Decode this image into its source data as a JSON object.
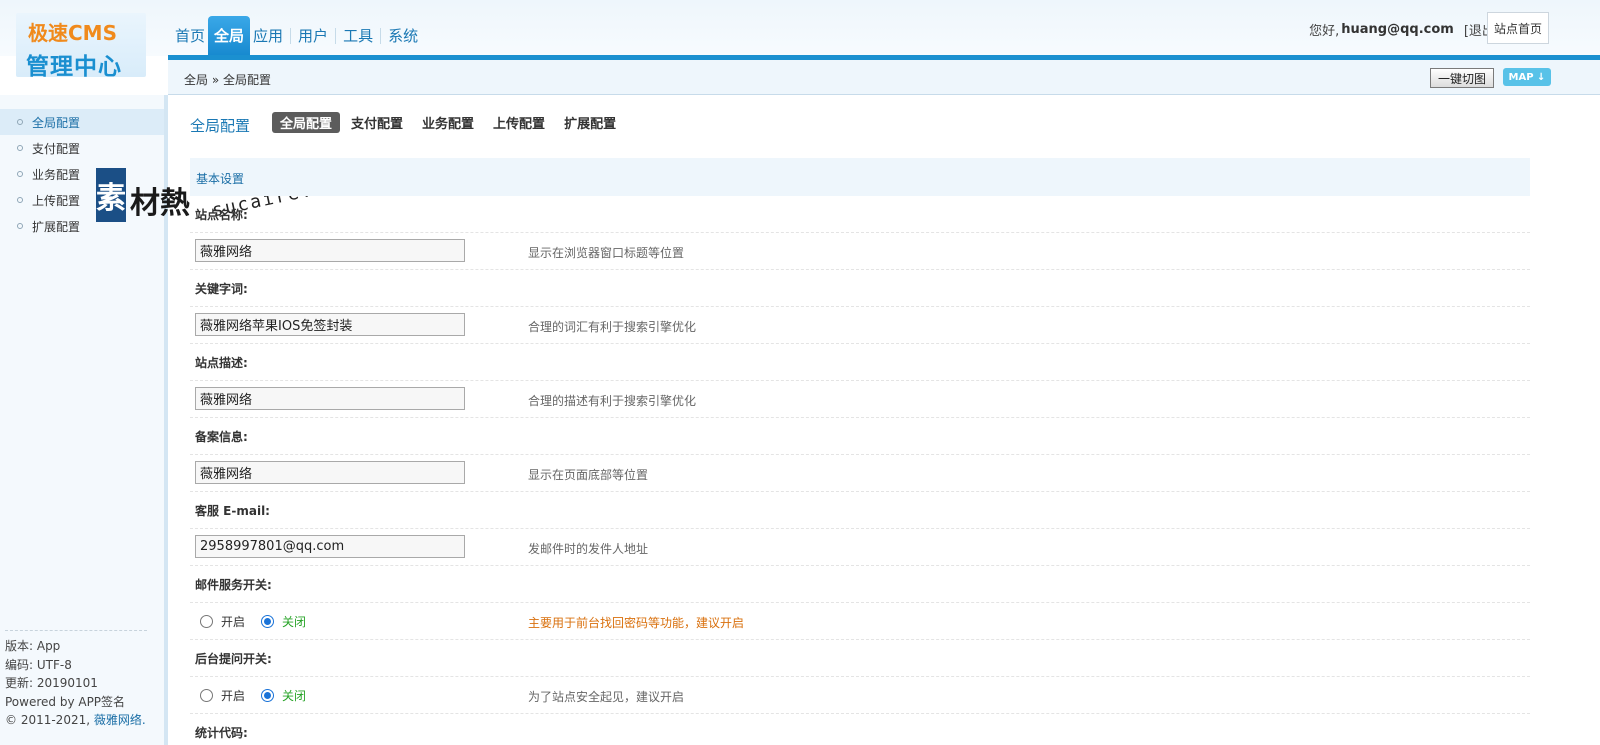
{
  "logo": {
    "line1": "极速CMS",
    "line2": "管理中心"
  },
  "nav": {
    "items": [
      "首页",
      "全局",
      "应用",
      "用户",
      "工具",
      "系统"
    ],
    "active_index": 1
  },
  "user": {
    "greeting": "您好,",
    "email": "huang@qq.com",
    "logout": "[退出]",
    "site_home": "站点首页"
  },
  "breadcrumb": "全局 » 全局配置",
  "toolbar": {
    "cut_label": "一键切图",
    "map_label": "MAP ↓"
  },
  "sidebar": {
    "items": [
      {
        "label": "全局配置",
        "active": true
      },
      {
        "label": "支付配置"
      },
      {
        "label": "业务配置"
      },
      {
        "label": "上传配置"
      },
      {
        "label": "扩展配置"
      }
    ],
    "footer": {
      "version": "版本: App",
      "encoding": "编码: UTF-8",
      "updated": "更新: 20190101",
      "powered": "Powered by APP签名",
      "copyright": "© 2011-2021,",
      "copyright_link": "薇雅网络."
    }
  },
  "watermark": {
    "icon_char": "素",
    "text": "材熱",
    "url": "sucaire.com"
  },
  "page": {
    "title": "全局配置",
    "tabs": [
      "全局配置",
      "支付配置",
      "业务配置",
      "上传配置",
      "扩展配置"
    ],
    "active_tab": 0,
    "section": "基本设置"
  },
  "fields": {
    "site_name": {
      "label": "站点名称:",
      "value": "薇雅网络",
      "hint": "显示在浏览器窗口标题等位置"
    },
    "keywords": {
      "label": "关键字词:",
      "value": "薇雅网络苹果IOS免签封装",
      "hint": "合理的词汇有利于搜索引擎优化"
    },
    "description": {
      "label": "站点描述:",
      "value": "薇雅网络",
      "hint": "合理的描述有利于搜索引擎优化"
    },
    "icp": {
      "label": "备案信息:",
      "value": "薇雅网络",
      "hint": "显示在页面底部等位置"
    },
    "email": {
      "label": "客服 E-mail:",
      "value": "2958997801@qq.com",
      "hint": "发邮件时的发件人地址"
    },
    "mail_switch": {
      "label": "邮件服务开关:",
      "on_label": "开启",
      "off_label": "关闭",
      "selected": "关闭",
      "hint": "主要用于前台找回密码等功能，建议开启"
    },
    "ask_switch": {
      "label": "后台提问开关:",
      "on_label": "开启",
      "off_label": "关闭",
      "selected": "关闭",
      "hint": "为了站点安全起见，建议开启"
    },
    "stats_code": {
      "label": "统计代码:"
    }
  },
  "colors": {
    "accent": "#1b90d0",
    "link": "#1a78b4",
    "warn": "#d9700d",
    "ok": "#28a428"
  }
}
